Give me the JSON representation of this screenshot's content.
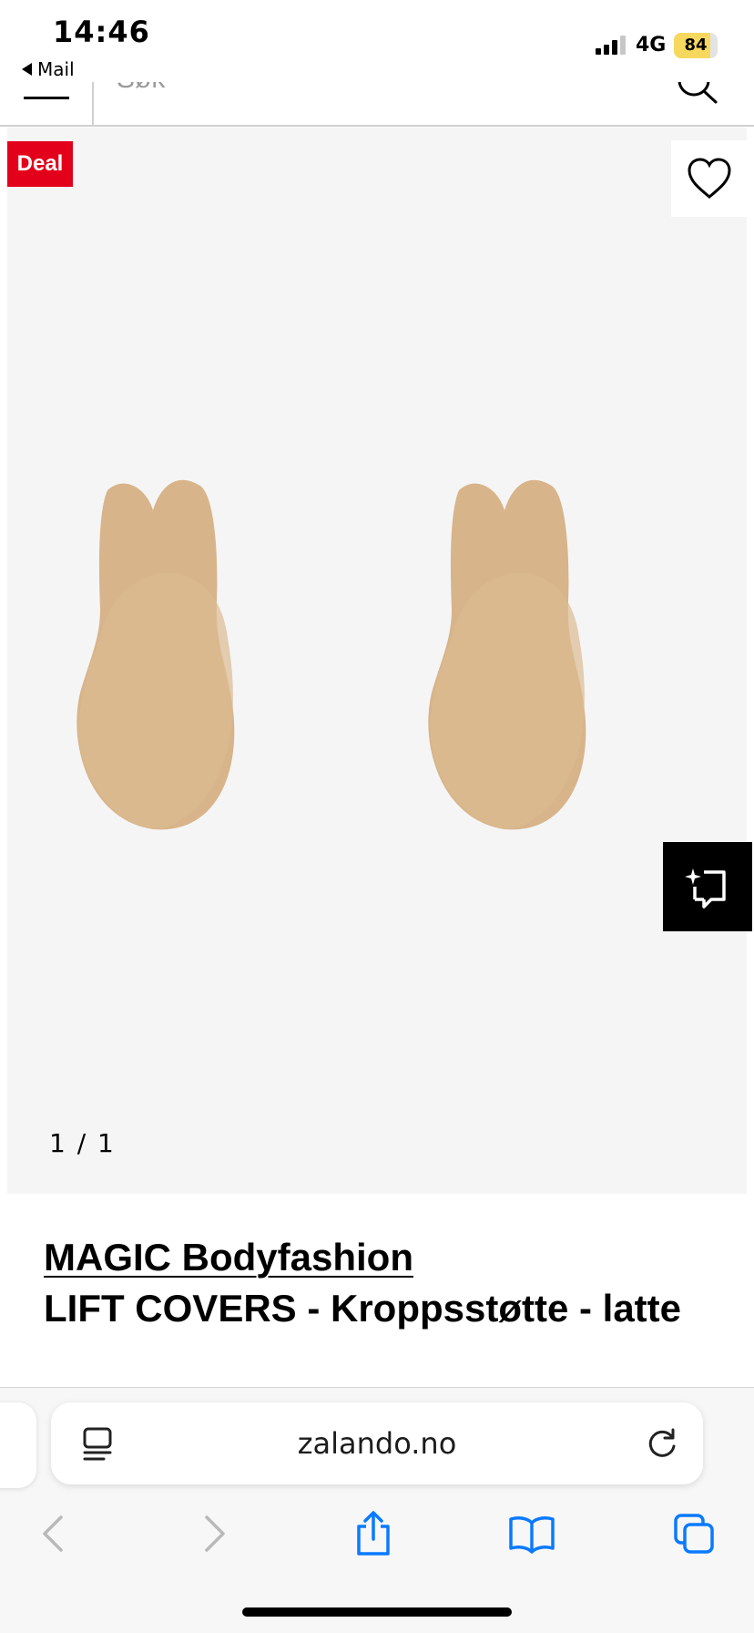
{
  "status_bar": {
    "time": "14:46",
    "back_label": "Mail",
    "network": "4G",
    "battery": "84",
    "battery_level_percent": 84,
    "icons": [
      "signal-icon",
      "battery-icon"
    ]
  },
  "header": {
    "search_stub": "Søk",
    "icons": [
      "menu-icon",
      "search-icon"
    ]
  },
  "product_image": {
    "deal_badge": "Deal",
    "counter": "1 / 1",
    "background_color": "#f5f5f5",
    "product_color": "#d8b48a",
    "icons": [
      "heart-icon",
      "find-similar-icon"
    ]
  },
  "product": {
    "brand": "MAGIC Bodyfashion",
    "name": "LIFT COVERS - Kroppsstøtte - latte"
  },
  "browser": {
    "url": "zalando.no",
    "icons": [
      "reader-icon",
      "reload-icon",
      "back-icon",
      "forward-icon",
      "share-icon",
      "bookmarks-icon",
      "tabs-icon"
    ]
  },
  "colors": {
    "deal_red": "#e3001b",
    "ios_blue": "#0a7aff"
  }
}
